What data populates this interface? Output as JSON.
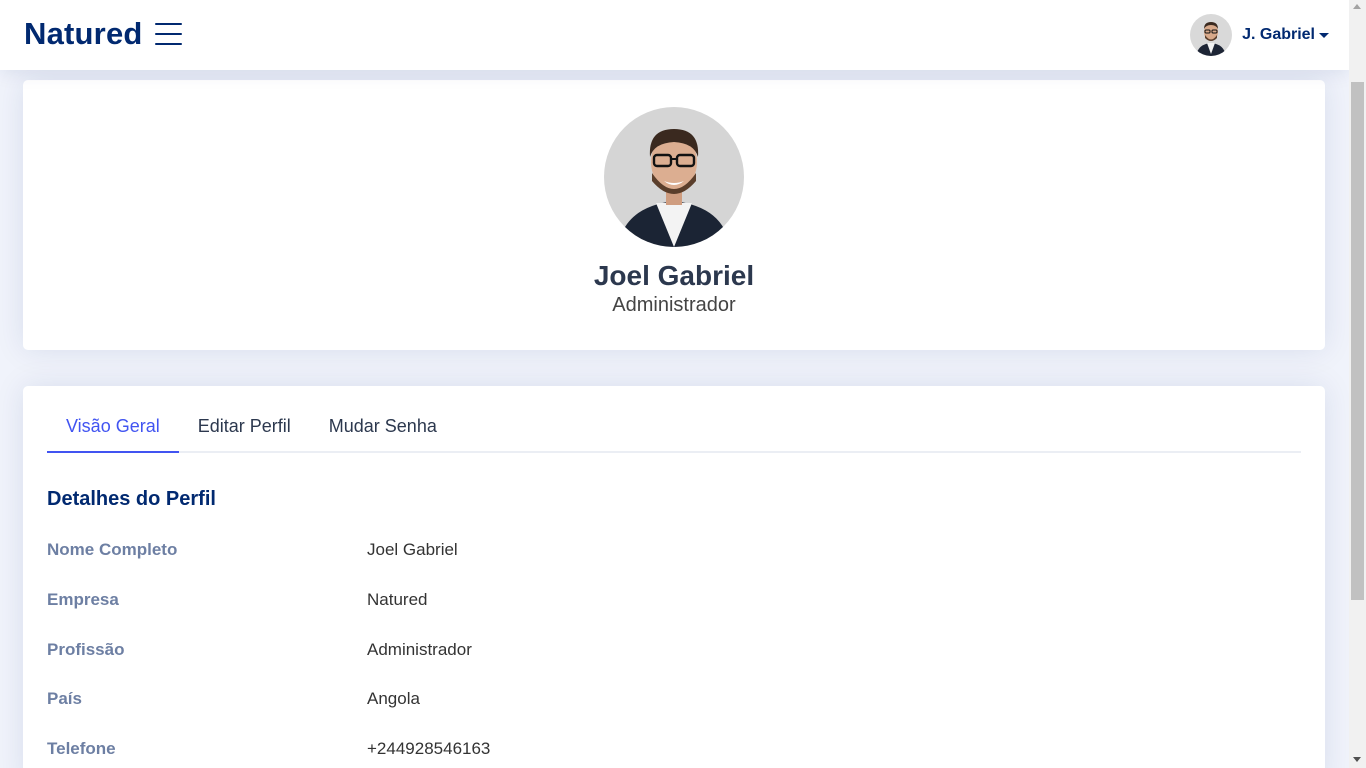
{
  "header": {
    "logo": "Natured",
    "user": {
      "name": "J. Gabriel"
    }
  },
  "profile": {
    "name": "Joel Gabriel",
    "role": "Administrador"
  },
  "tabs": [
    {
      "label": "Visão Geral",
      "active": true
    },
    {
      "label": "Editar Perfil",
      "active": false
    },
    {
      "label": "Mudar Senha",
      "active": false
    }
  ],
  "details": {
    "title": "Detalhes do Perfil",
    "rows": [
      {
        "label": "Nome Completo",
        "value": "Joel Gabriel"
      },
      {
        "label": "Empresa",
        "value": "Natured"
      },
      {
        "label": "Profissão",
        "value": "Administrador"
      },
      {
        "label": "País",
        "value": "Angola"
      },
      {
        "label": "Telefone",
        "value": "+244928546163"
      }
    ]
  },
  "colors": {
    "brand": "#012970",
    "accent": "#4154f1",
    "background": "#f0f3fb",
    "label": "#6d7fa3"
  },
  "icons": {
    "menu": "hamburger-menu-icon",
    "dropdown": "caret-down-icon"
  }
}
